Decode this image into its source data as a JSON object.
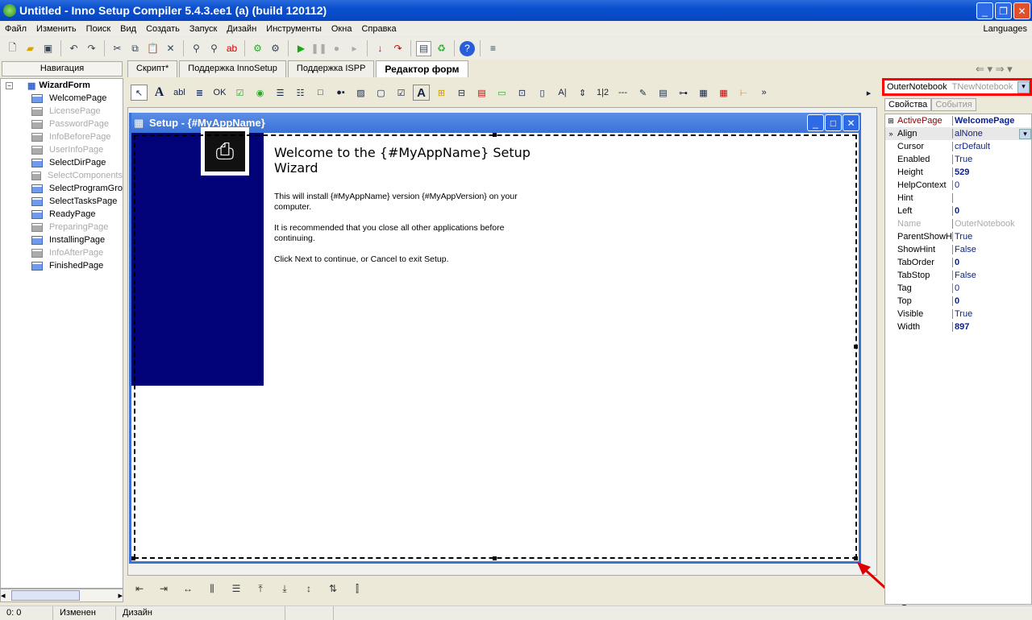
{
  "window": {
    "title": "Untitled - Inno Setup Compiler 5.4.3.ee1 (a) (build 120112)"
  },
  "menu": [
    "Файл",
    "Изменить",
    "Поиск",
    "Вид",
    "Создать",
    "Запуск",
    "Дизайн",
    "Инструменты",
    "Окна",
    "Справка"
  ],
  "languages": "Languages",
  "nav_header": "Навигация",
  "tabs": [
    "Скрипт*",
    "Поддержка InnoSetup",
    "Поддержка ISPP",
    "Редактор форм"
  ],
  "tree": {
    "root": "WizardForm",
    "pages": [
      {
        "label": "WelcomePage",
        "enabled": true
      },
      {
        "label": "LicensePage",
        "enabled": false
      },
      {
        "label": "PasswordPage",
        "enabled": false
      },
      {
        "label": "InfoBeforePage",
        "enabled": false
      },
      {
        "label": "UserInfoPage",
        "enabled": false
      },
      {
        "label": "SelectDirPage",
        "enabled": true
      },
      {
        "label": "SelectComponents",
        "enabled": false
      },
      {
        "label": "SelectProgramGro",
        "enabled": true
      },
      {
        "label": "SelectTasksPage",
        "enabled": true
      },
      {
        "label": "ReadyPage",
        "enabled": true
      },
      {
        "label": "PreparingPage",
        "enabled": false
      },
      {
        "label": "InstallingPage",
        "enabled": true
      },
      {
        "label": "InfoAfterPage",
        "enabled": false
      },
      {
        "label": "FinishedPage",
        "enabled": true
      }
    ]
  },
  "setup": {
    "title": "Setup - {#MyAppName}",
    "welcome": "Welcome to the {#MyAppName} Setup Wizard",
    "p1": "This will install {#MyAppName} version {#MyAppVersion} on your computer.",
    "p2": "It is recommended that you close all other applications before continuing.",
    "p3": "Click Next to continue, or Cancel to exit Setup."
  },
  "inspector": {
    "component": "OuterNotebook",
    "type": "TNewNotebook",
    "tabs": [
      "Свойства",
      "События"
    ],
    "props": [
      [
        "ActivePage",
        "WelcomePage"
      ],
      [
        "Align",
        "alNone"
      ],
      [
        "Cursor",
        "crDefault"
      ],
      [
        "Enabled",
        "True"
      ],
      [
        "Height",
        "529"
      ],
      [
        "HelpContext",
        "0"
      ],
      [
        "Hint",
        ""
      ],
      [
        "Left",
        "0"
      ],
      [
        "Name",
        "OuterNotebook"
      ],
      [
        "ParentShowHi",
        "True"
      ],
      [
        "ShowHint",
        "False"
      ],
      [
        "TabOrder",
        "0"
      ],
      [
        "TabStop",
        "False"
      ],
      [
        "Tag",
        "0"
      ],
      [
        "Top",
        "0"
      ],
      [
        "Visible",
        "True"
      ],
      [
        "Width",
        "897"
      ]
    ]
  },
  "status": [
    "0:  0",
    "Изменен",
    "Дизайн"
  ],
  "colors": {
    "accent": "#0a4fd0",
    "highlight": "#ff0000",
    "banner": "#020278"
  }
}
